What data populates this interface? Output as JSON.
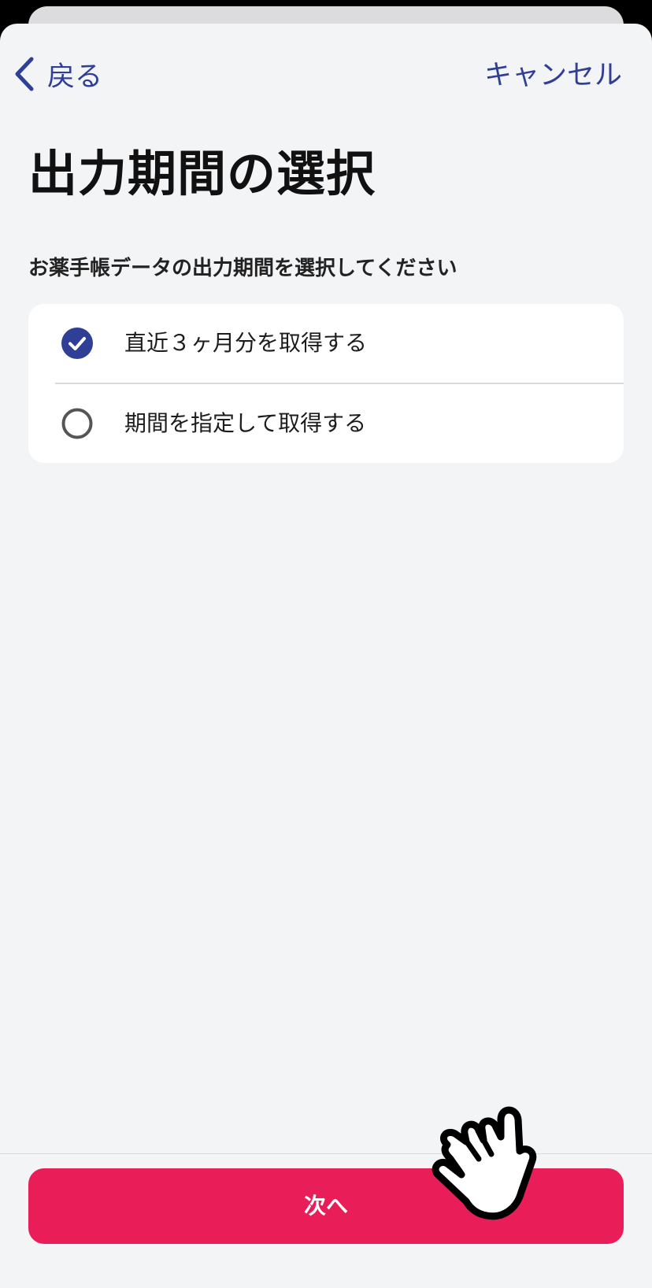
{
  "nav": {
    "back_label": "戻る",
    "cancel_label": "キャンセル"
  },
  "page": {
    "title": "出力期間の選択",
    "subtitle": "お薬手帳データの出力期間を選択してください"
  },
  "options": [
    {
      "label": "直近３ヶ月分を取得する",
      "selected": true
    },
    {
      "label": "期間を指定して取得する",
      "selected": false
    }
  ],
  "footer": {
    "next_label": "次へ"
  },
  "colors": {
    "accent": "#2f3f95",
    "primary_button": "#e91e58",
    "background": "#f3f4f6"
  },
  "icons": {
    "back": "chevron-left-icon",
    "selected": "check-circle-icon",
    "unselected": "radio-empty-icon",
    "pointer": "pointing-hand-icon"
  }
}
